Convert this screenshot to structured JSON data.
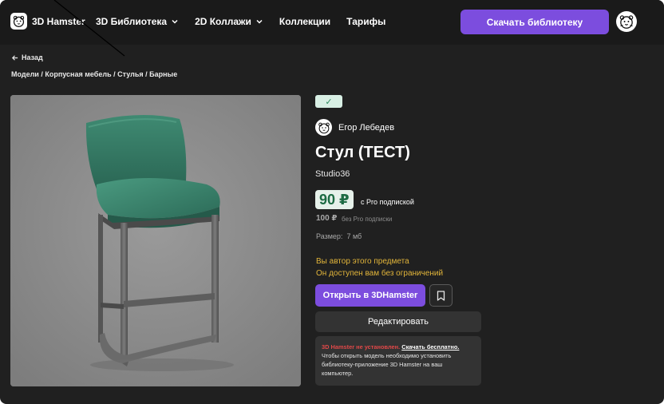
{
  "header": {
    "logo_text": "3D Hamster",
    "nav": [
      {
        "label": "3D Библиотека",
        "has_dropdown": true
      },
      {
        "label": "2D Коллажи",
        "has_dropdown": true
      },
      {
        "label": "Коллекции",
        "has_dropdown": false
      },
      {
        "label": "Тарифы",
        "has_dropdown": false
      }
    ],
    "download_label": "Скачать библиотеку",
    "icons": {
      "logo": "hamster-logo-icon",
      "avatar": "hamster-avatar-icon",
      "chevron": "chevron-down-icon"
    }
  },
  "back_label": "Назад",
  "breadcrumb": "Модели / Корпусная мебель / Стулья / Барные",
  "product": {
    "verified_mark": "✓",
    "author": "Егор Лебедев",
    "title": "Стул (ТЕСТ)",
    "studio": "Studio36",
    "price_pro": "90 ₽",
    "price_pro_label": "с Pro подпиской",
    "price_base": "100 ₽",
    "price_base_label": "без Pro подписки",
    "size_label": "Размер:",
    "size_value": "7 мб",
    "owner_line1": "Вы автор этого предмета",
    "owner_line2": "Он доступен вам без ограничений",
    "open_label": "Открыть в 3DHamster",
    "edit_label": "Редактировать",
    "notice": {
      "warning": "3D Hamster не установлен.",
      "link": "Скачать бесплатно.",
      "text": "Чтобы открыть модель необходимо установить библиотеку-приложение 3D Hamster на ваш компьютер."
    }
  },
  "colors": {
    "accent": "#7c4dde",
    "background": "#202020",
    "header": "#1a1a1a",
    "price_badge": "#e6f1ea",
    "price_text": "#1d6b43",
    "owner_text": "#e2b53a",
    "warning": "#e04848"
  }
}
